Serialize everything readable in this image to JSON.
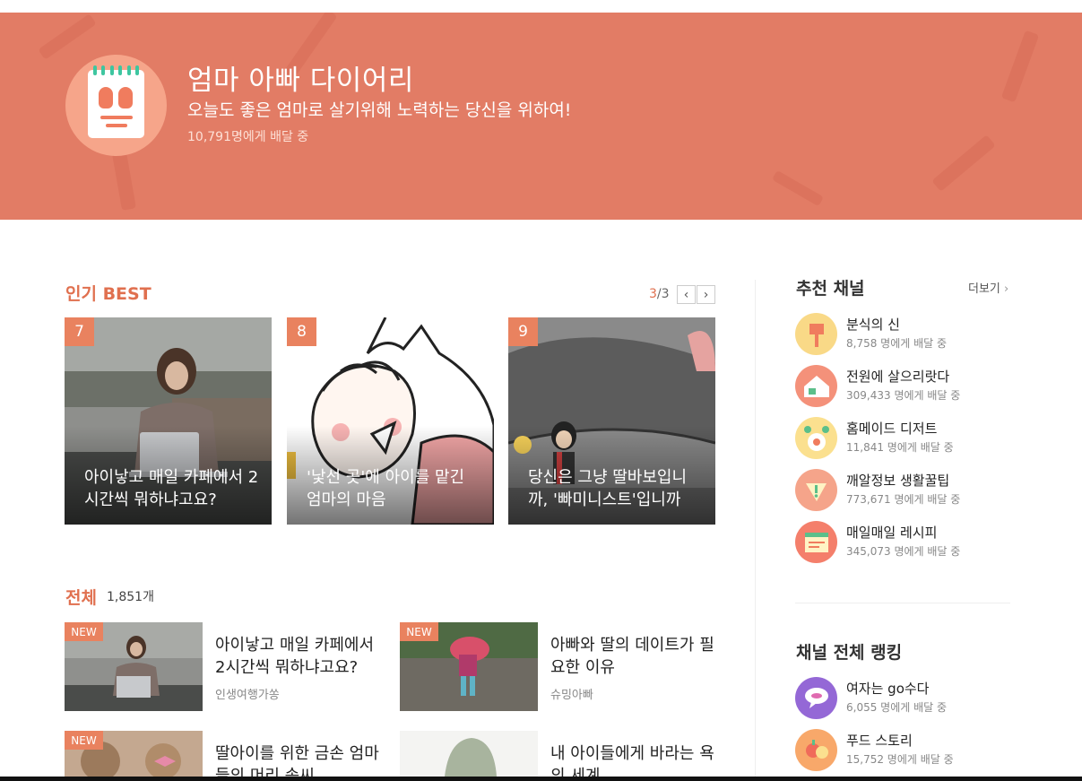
{
  "header": {
    "title": "엄마 아빠 다이어리",
    "subtitle": "오늘도 좋은 엄마로 살기위해 노력하는 당신을 위하여!",
    "subscribers": "10,791명에게 배달 중"
  },
  "best": {
    "title": "인기 BEST",
    "page_current": "3",
    "page_total": "/3",
    "prev_label": "‹",
    "next_label": "›",
    "items": [
      {
        "rank": "7",
        "title": "아이낳고 매일 카페에서 2시간씩 뭐하냐고요?"
      },
      {
        "rank": "8",
        "title": "'낯선 곳'에 아이를 맡긴 엄마의 마음"
      },
      {
        "rank": "9",
        "title": "당신은 그냥 딸바보입니까, '빠미니스트'입니까"
      }
    ]
  },
  "all": {
    "title": "전체",
    "count": "1,851개",
    "items": [
      {
        "badge": "NEW",
        "title": "아이낳고 매일 카페에서 2시간씩 뭐하냐고요?",
        "author": "인생여행가쏭"
      },
      {
        "badge": "NEW",
        "title": "아빠와 딸의 데이트가 필요한 이유",
        "author": "슈밍아빠"
      },
      {
        "badge": "NEW",
        "title": "딸아이를 위한 금손 엄마들의 머리 솜씨",
        "author": ""
      },
      {
        "badge": "",
        "title": "내 아이들에게 바라는 욕의 세계",
        "author": ""
      }
    ]
  },
  "recommended": {
    "title": "추천 채널",
    "more_label": "더보기",
    "items": [
      {
        "name": "분식의 신",
        "count": "8,758 명에게 배달 중",
        "color": "#f9d987"
      },
      {
        "name": "전원에 살으리랏다",
        "count": "309,433 명에게 배달 중",
        "color": "#f4917a"
      },
      {
        "name": "홈메이드 디저트",
        "count": "11,841 명에게 배달 중",
        "color": "#fbe08f"
      },
      {
        "name": "깨알정보 생활꿀팁",
        "count": "773,671 명에게 배달 중",
        "color": "#f5a48a"
      },
      {
        "name": "매일매일 레시피",
        "count": "345,073 명에게 배달 중",
        "color": "#f47f6b"
      }
    ]
  },
  "ranking": {
    "title": "채널 전체 랭킹",
    "items": [
      {
        "name": "여자는 go수다",
        "count": "6,055 명에게 배달 중",
        "color": "#9468d6"
      },
      {
        "name": "푸드 스토리",
        "count": "15,752 명에게 배달 중",
        "color": "#f8a86a"
      }
    ]
  },
  "colors": {
    "accent": "#e0704f",
    "banner": "#e27c65",
    "badge": "#e9825f"
  }
}
